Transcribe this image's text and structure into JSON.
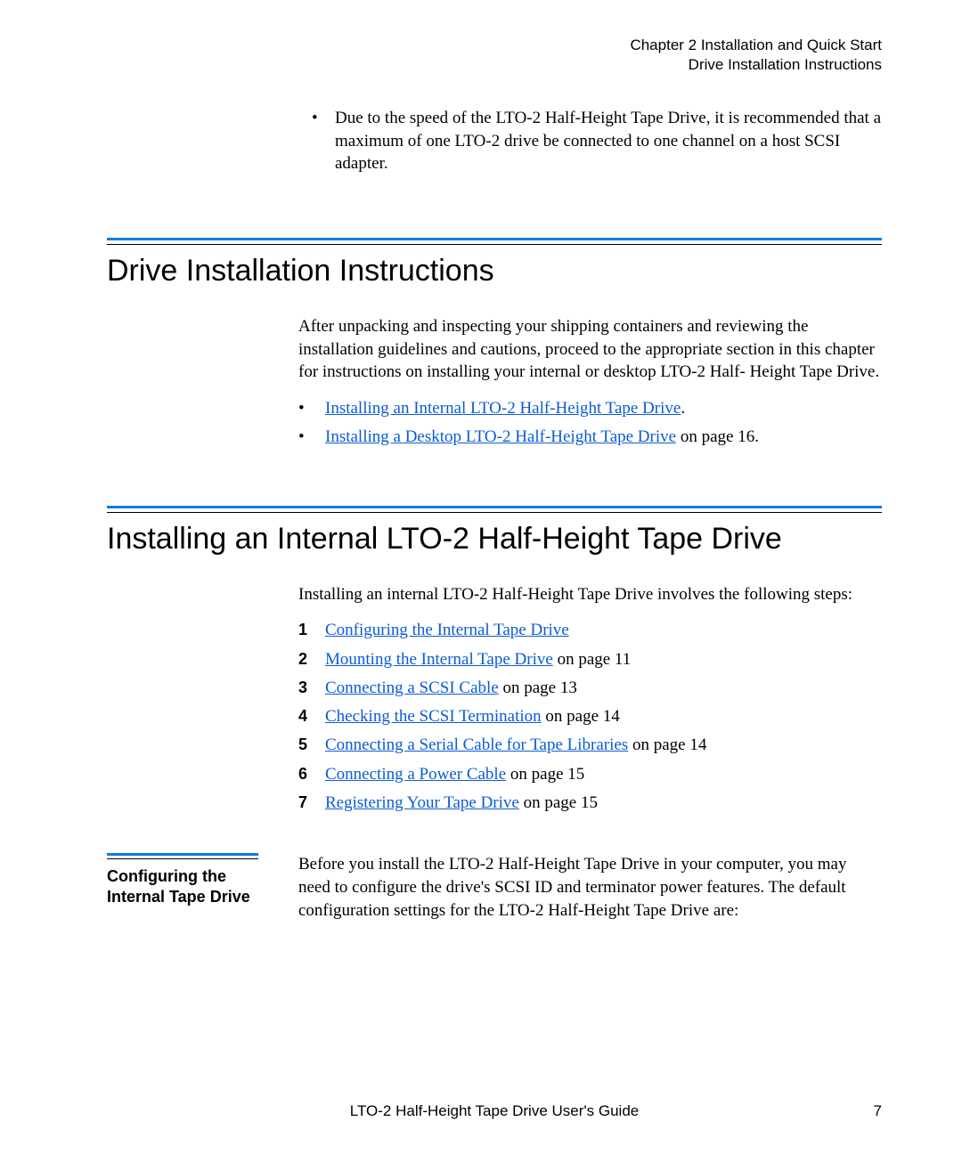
{
  "header": {
    "line1": "Chapter 2  Installation and Quick Start",
    "line2": "Drive Installation Instructions"
  },
  "intro_bullet": "Due to the speed of the LTO-2 Half-Height Tape Drive, it is recommended that a maximum of one LTO-2 drive be connected to one channel on a host SCSI adapter.",
  "section1": {
    "title": "Drive Installation Instructions",
    "para": "After unpacking and inspecting your shipping containers and reviewing the installation guidelines and cautions, proceed to the appropriate section in this chapter for instructions on installing your internal or desktop LTO-2 Half- Height Tape Drive.",
    "bullets": [
      {
        "link": "Installing an Internal LTO-2 Half-Height Tape Drive",
        "suffix": "."
      },
      {
        "link": "Installing a Desktop LTO-2 Half-Height Tape Drive",
        "suffix": " on page 16."
      }
    ]
  },
  "section2": {
    "title": "Installing an Internal LTO-2 Half-Height Tape Drive",
    "para": "Installing an internal LTO-2 Half-Height Tape Drive involves the following steps:",
    "steps": [
      {
        "num": "1",
        "link": "Configuring the Internal Tape Drive",
        "suffix": ""
      },
      {
        "num": "2",
        "link": "Mounting the Internal Tape Drive",
        "suffix": " on page 11"
      },
      {
        "num": "3",
        "link": "Connecting a SCSI Cable",
        "suffix": " on page 13"
      },
      {
        "num": "4",
        "link": "Checking the SCSI Termination",
        "suffix": " on page 14"
      },
      {
        "num": "5",
        "link": "Connecting a Serial Cable for Tape Libraries",
        "suffix": " on page 14"
      },
      {
        "num": "6",
        "link": "Connecting a Power Cable",
        "suffix": " on page 15"
      },
      {
        "num": "7",
        "link": "Registering Your Tape Drive",
        "suffix": " on page 15"
      }
    ]
  },
  "subsection": {
    "label": "Configuring the Internal Tape Drive",
    "body": "Before you install the LTO-2  Half-Height Tape Drive in your computer, you may need to configure the drive's SCSI ID and terminator power features. The default configuration settings for the LTO-2 Half-Height Tape Drive are:"
  },
  "footer": {
    "title": "LTO-2 Half-Height Tape Drive User's Guide",
    "page": "7"
  }
}
